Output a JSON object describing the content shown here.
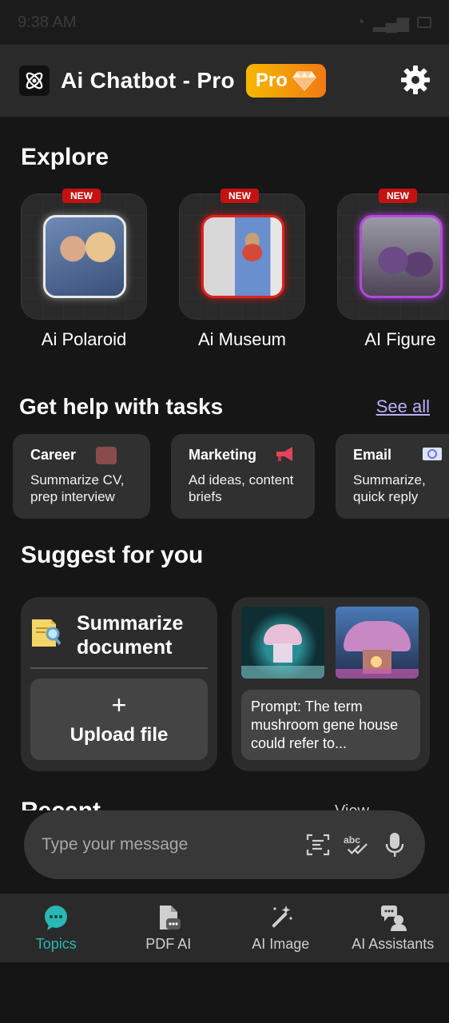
{
  "status_bar": {
    "time": "9:38 AM"
  },
  "header": {
    "title": "Ai Chatbot - Pro",
    "pro_label": "Pro"
  },
  "explore": {
    "title": "Explore",
    "items": [
      {
        "label": "Ai Polaroid",
        "badge": "NEW"
      },
      {
        "label": "Ai Museum",
        "badge": "NEW"
      },
      {
        "label": "AI Figure",
        "badge": "NEW"
      }
    ]
  },
  "tasks": {
    "title": "Get help with tasks",
    "see_all": "See all",
    "items": [
      {
        "title": "Career",
        "desc": "Summarize CV, prep interview",
        "icon": "briefcase-icon",
        "color": "#8a4b4b"
      },
      {
        "title": "Marketing",
        "desc": "Ad ideas, content briefs",
        "icon": "megaphone-icon",
        "color": "#e0445b"
      },
      {
        "title": "Email",
        "desc": "Summarize, quick reply",
        "icon": "envelope-icon",
        "color": "#9aa3ff"
      }
    ]
  },
  "suggest": {
    "title": "Suggest for you",
    "summarize_title": "Summarize document",
    "upload_label": "Upload file",
    "prompt_text": "Prompt: The term mushroom gene house could refer to..."
  },
  "recent": {
    "title": "Recent",
    "view": "View"
  },
  "composer": {
    "placeholder": "Type your message"
  },
  "bottom_nav": {
    "items": [
      {
        "label": "Topics",
        "icon": "chat-bubble-icon",
        "active": true
      },
      {
        "label": "PDF AI",
        "icon": "pdf-icon",
        "active": false
      },
      {
        "label": "AI Image",
        "icon": "magic-wand-icon",
        "active": false
      },
      {
        "label": "AI Assistants",
        "icon": "assistant-icon",
        "active": false
      }
    ]
  },
  "colors": {
    "accent": "#2ab8b2",
    "pro_gradient_start": "#f6b800",
    "pro_gradient_end": "#f17a13",
    "link": "#b9b0f5"
  }
}
